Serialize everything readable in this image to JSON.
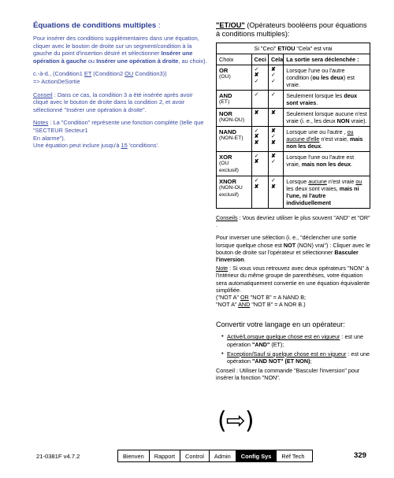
{
  "left": {
    "title": "Équations de conditions multiples",
    "title_suffix": " :",
    "para1_a": "Pour insérer des conditions supplémentaires dans une équation, cliquer avec le bouton de droite sur un segment/condition à la gauche du point d'insertion désiré et sélectionner ",
    "para1_b": "Insérer une opération à gauche",
    "para1_c": " ou ",
    "para1_d": "Insérer une opération à droite",
    "para1_e": ", au choix).",
    "example_line1_a": "c.-à-d., (Condition1 ",
    "example_line1_et": "ET",
    "example_line1_b": " (Condition2 ",
    "example_line1_ou": "OU",
    "example_line1_c": " Condition3))",
    "example_line2": "=> ActionDeSortie",
    "conseil_label": "Conseil",
    "conseil_text": " :  Dans ce cas, la condition 3 a été insérée après avoir cliqué avec le bouton de droite dans la condition 2, et avoir sélectionné \"Insérer une opération à droite\".",
    "notes_label": "Notes",
    "notes_text_a": " :  La \"Condition\" représente une fonction complète (telle que  \"SECTEUR   Secteur1",
    "notes_text_b": "En alarme\").",
    "notes_text_c": "Une équation peut inclure jusqu'à ",
    "notes_count": "15",
    "notes_text_d": " 'conditions'."
  },
  "right": {
    "heading_bold": "\"ET/OU\"",
    "heading_rest": " (Opérateurs booléens pour équations à conditions multiples):",
    "table": {
      "banner_pre": "Si  \"Ceci\"  ",
      "banner_bold": "ET/OU",
      "banner_post": "  \"Cela\" est vrai",
      "columns": [
        "Choix",
        "Ceci",
        "Cela",
        "La sortie sera déclenchée :"
      ],
      "rows": [
        {
          "name": "OR",
          "alt": "(OU)",
          "a": [
            "check",
            "x",
            "check"
          ],
          "b": [
            "x",
            "check",
            "check"
          ],
          "out_html": "Lorsque l'une ou l'autre condition (<b>ou les deux</b>) est vraie.",
          "out_text": "Lorsque l'une ou l'autre condition (ou les deux) est vraie."
        },
        {
          "name": "AND",
          "alt": "(ET)",
          "a": [
            "check"
          ],
          "b": [
            "check"
          ],
          "out_html": "Seulement lorsque les <b>deux sont vraies</b>.",
          "out_text": "Seulement lorsque les deux sont vraies."
        },
        {
          "name": "NOR",
          "alt": "(NON-OU)",
          "a": [
            "x"
          ],
          "b": [
            "x"
          ],
          "out_html": "Seulement lorsque aucune n'est vraie (i. e., les deux <b>NON</b> vraie).",
          "out_text": "Seulement lorsque aucune n'est vraie (i. e., les deux NON vraie)."
        },
        {
          "name": "NAND",
          "alt": "(NON-ET)",
          "a": [
            "check",
            "x",
            "x"
          ],
          "b": [
            "x",
            "check",
            "x"
          ],
          "out_html": "Lorsque une ou l'autre , <u>ou aucune d'elle</u> n'est vraie, <b>mais non les deux</b>.",
          "out_text": "Lorsque une ou l'autre , ou aucune d'elle n'est vraie, mais non les deux."
        },
        {
          "name": "XOR",
          "alt": "(OU exclusif)",
          "a": [
            "check",
            "x"
          ],
          "b": [
            "x",
            "check"
          ],
          "out_html": "Lorsque l'une ou l'autre est vraie, <b>mais non les deux</b>.",
          "out_text": "Lorsque l'une ou l'autre est vraie, mais non les deux."
        },
        {
          "name": "XNOR",
          "alt": "(NON-OU exclusif)",
          "a": [
            "check",
            "x"
          ],
          "b": [
            "check",
            "x"
          ],
          "out_html": "Lorsque <u>aucune</u> n'est vraie <u>ou</u> les deux sont vraies, <b>mais ni l'une, ni l'autre individuellement</b>",
          "out_text": "Lorsque aucune n'est vraie ou les deux sont vraies, mais ni l'une, ni l'autre individuellement"
        }
      ]
    },
    "conseils_label": "Conseils",
    "conseils_text": " :  Vous devriez utiliser le plus souvent \"AND\" et  \"OR\" .",
    "invert_para_a": "Pour inverser une sélection (i. e., \"déclencher une sortie lorsque quelque chose est ",
    "invert_para_not": "NOT",
    "invert_para_b": " (NON)  vrai\") : Cliquer avec le bouton de droite sur l'opérateur et sélectionner ",
    "invert_para_c": "Basculer l'inversion",
    "invert_para_d": ".",
    "note_label": "Note",
    "note_text": " :  Si vous vous retrouvez avec deux opérateurs \"NON\" à l'intérieur du même groupe de parenthèses, votre équation sera automatiquement convertie en une équation équivalente simplifiée.",
    "equiv_line1_a": "(\"NOT A\"  ",
    "equiv_line1_or": "OR",
    "equiv_line1_b": "  \"NOT B\"  = A   NAND   B;",
    "equiv_line2_a": " \"NOT A\" ",
    "equiv_line2_and": "AND",
    "equiv_line2_b": " \"NOT B\"  = A   NOR   B.)",
    "subheading": "Convertir votre langage en un opérateur:",
    "bullets": [
      {
        "underline": "Activé/Lorsque quelque chose est en vigueur",
        "mid": " :  est une opération  ",
        "bold": "\"AND\"",
        "tail": " (ET);"
      },
      {
        "underline": "Exception/Sauf si quelque chose est en vigueur",
        "mid": " : est une opération  ",
        "bold": "\"AND NOT\" (ET  NON)",
        "tail": ";"
      }
    ],
    "final_conseil_label": "Conseil",
    "final_conseil_text": " :  Utiliser la commande \"Basculer l'inversion\" pour insérer la fonction \"NON\".",
    "arrow_glyph": "(⇨)"
  },
  "footer": {
    "doc_id": "21-0381F v4.7.2",
    "tabs": [
      {
        "label": "Bienven",
        "active": false
      },
      {
        "label": "Rapport",
        "active": false
      },
      {
        "label": "Control",
        "active": false
      },
      {
        "label": "Admin",
        "active": false
      },
      {
        "label": "Config Sys",
        "active": true
      },
      {
        "label": "Réf Tech",
        "active": false
      }
    ],
    "page_number": "329"
  },
  "colors": {
    "left_heading": "#2b3c8f",
    "left_body": "#3a4aa0",
    "active_tab_bg": "#000000"
  }
}
